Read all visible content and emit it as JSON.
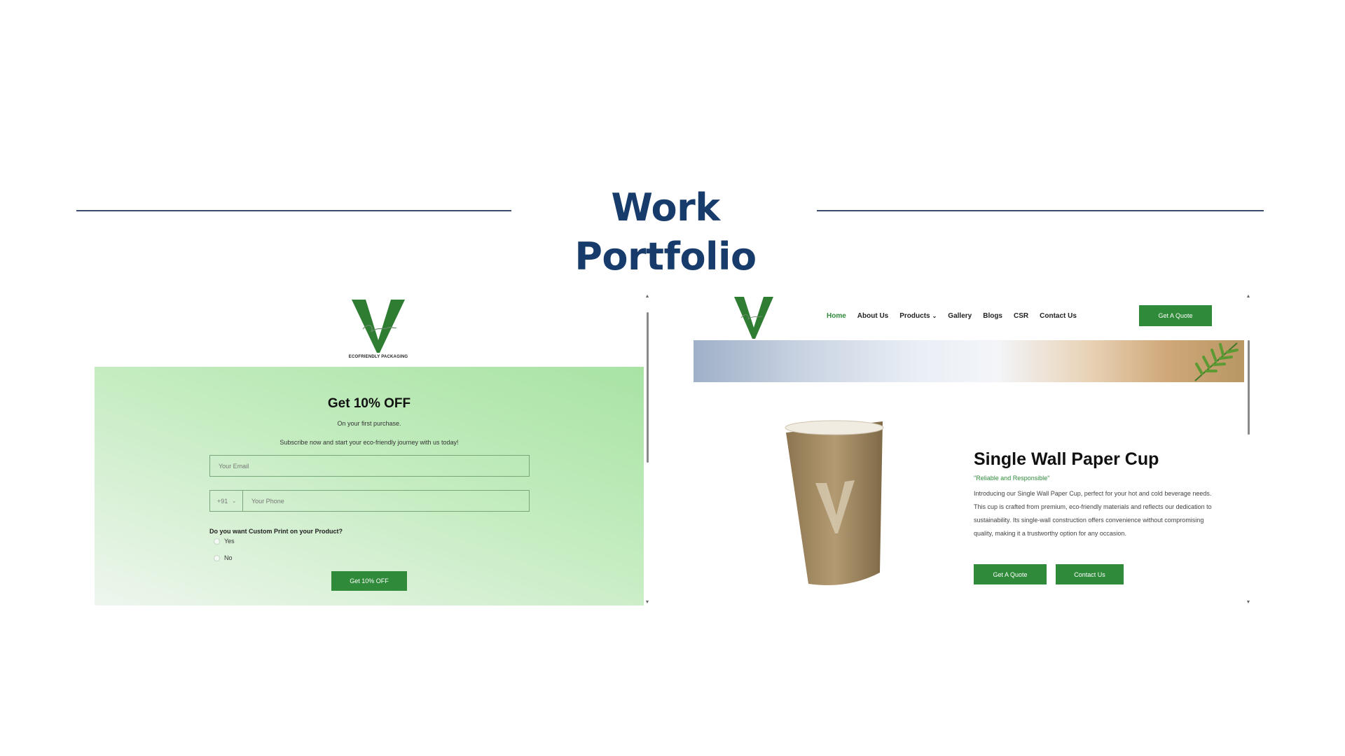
{
  "page": {
    "title": "Work Portfolio"
  },
  "left_shot": {
    "logo_caption": "ECOFRIENDLY PACKAGING",
    "promo": {
      "title": "Get 10% OFF",
      "subtitle": "On your first purchase.",
      "note": "Subscribe now and start your eco-friendly journey with us today!",
      "email_placeholder": "Your Email",
      "phone_code": "+91",
      "phone_placeholder": "Your Phone",
      "question": "Do you want Custom Print on your Product?",
      "options": [
        "Yes",
        "No"
      ],
      "button": "Get 10% OFF"
    }
  },
  "right_shot": {
    "nav": {
      "items": [
        "Home",
        "About Us",
        "Products",
        "Gallery",
        "Blogs",
        "CSR",
        "Contact Us"
      ],
      "products_chevron": "⌄",
      "cta": "Get A Quote"
    },
    "product": {
      "title": "Single Wall Paper Cup",
      "tagline": "\"Reliable and Responsible\"",
      "description": "Introducing our Single Wall Paper Cup, perfect for your hot and cold beverage needs. This cup is crafted from premium, eco-friendly materials and reflects our dedication to sustainability. Its single-wall construction offers convenience without compromising quality, making it a trustworthy option for any occasion.",
      "button_quote": "Get A Quote",
      "button_contact": "Contact Us"
    }
  },
  "colors": {
    "heading": "#173c6b",
    "brand_green": "#2f8a3a",
    "rule": "#3a4a6b"
  }
}
